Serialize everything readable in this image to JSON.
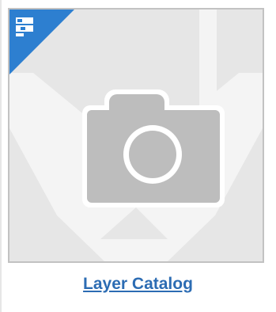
{
  "item": {
    "title": "Layer Catalog",
    "thumbnail_icon": "camera-placeholder-icon",
    "badge_icon": "layer-catalog-icon"
  },
  "colors": {
    "link": "#2c6cb3",
    "badge": "#2d7fd0",
    "thumbnail_background": "#e6e6e6",
    "placeholder_road": "#f3f3f3",
    "camera": "#bdbdbd",
    "border": "#c2c2c2"
  }
}
